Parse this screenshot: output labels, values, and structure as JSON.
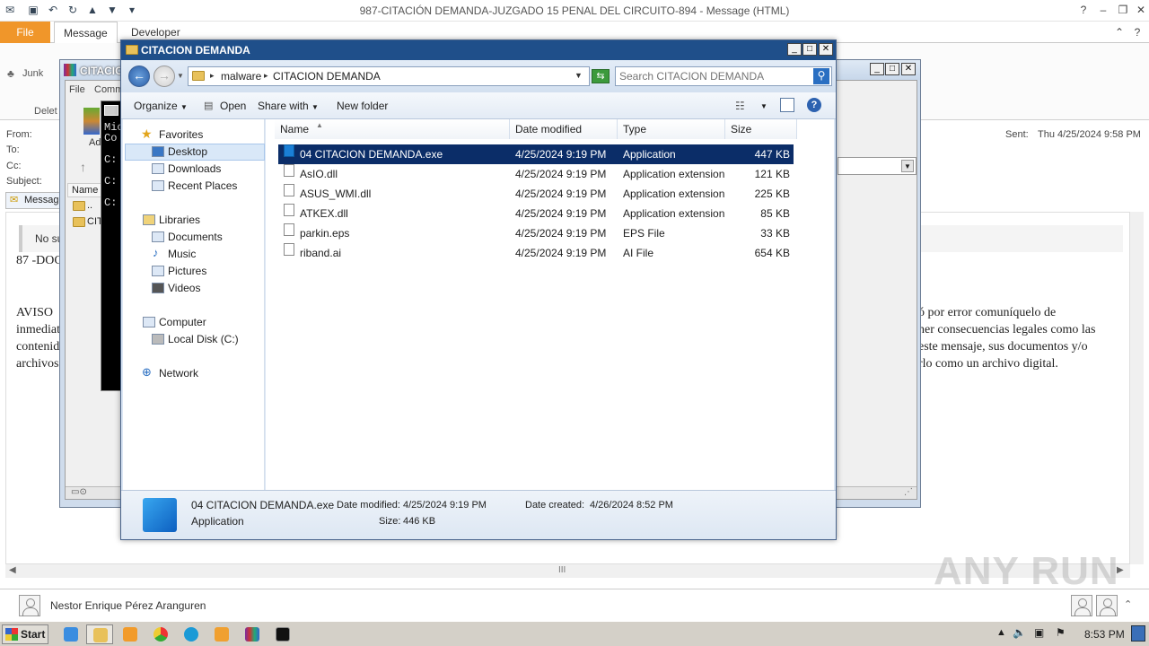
{
  "outlook": {
    "window_title": "987-CITACIÓN  DEMANDA-JUZGADO 15 PENAL DEL CIRCUITO-894  -  Message (HTML)",
    "tabs": [
      "File",
      "Message",
      "Developer"
    ],
    "ribbon": {
      "junk_label": "Junk",
      "delete_label": "Delet"
    },
    "header": {
      "from_label": "From:",
      "to_label": "To:",
      "cc_label": "Cc:",
      "subject_label": "Subject:",
      "sent_label": "Sent:",
      "sent_value": "Thu 4/25/2024 9:58 PM"
    },
    "message_tab_label": "Message",
    "body": {
      "notice_fragment": "No su",
      "line_87": "87 -DOC",
      "aviso_words": [
        "AVISO",
        "inmediat",
        "contenid",
        "archivos"
      ],
      "right_fragments": [
        "ó por error comuníquelo de",
        "ner consecuencias legales como las",
        "este mensaje, sus documentos y/o",
        "rlo como un archivo digital."
      ]
    },
    "people_name": "Nestor Enrique Pérez Aranguren",
    "hscroll_glyph": "III"
  },
  "winrar": {
    "title": "CITACIO",
    "menu": [
      "File",
      "Comm"
    ],
    "add_label": "Ad",
    "col_name": "Name",
    "rows": [
      "..",
      "CIT"
    ]
  },
  "cmd": {
    "lines": [
      "Mic",
      "Co",
      "C:",
      "C:",
      "C:"
    ]
  },
  "explorer": {
    "title": "CITACION DEMANDA",
    "breadcrumb": [
      "malware",
      "CITACION DEMANDA"
    ],
    "search_placeholder": "Search CITACION DEMANDA",
    "toolbar": {
      "organize": "Organize",
      "open": "Open",
      "share_with": "Share with",
      "new_folder": "New folder"
    },
    "nav": {
      "favorites": "Favorites",
      "favorites_items": [
        "Desktop",
        "Downloads",
        "Recent Places"
      ],
      "libraries": "Libraries",
      "libraries_items": [
        "Documents",
        "Music",
        "Pictures",
        "Videos"
      ],
      "computer": "Computer",
      "computer_items": [
        "Local Disk (C:)"
      ],
      "network": "Network",
      "selected": "Desktop"
    },
    "columns": [
      "Name",
      "Date modified",
      "Type",
      "Size"
    ],
    "files": [
      {
        "name": "04 CITACION DEMANDA.exe",
        "date": "4/25/2024 9:19 PM",
        "type": "Application",
        "size": "447 KB",
        "icon": "exe",
        "selected": true
      },
      {
        "name": "AsIO.dll",
        "date": "4/25/2024 9:19 PM",
        "type": "Application extension",
        "size": "121 KB",
        "icon": "dll"
      },
      {
        "name": "ASUS_WMI.dll",
        "date": "4/25/2024 9:19 PM",
        "type": "Application extension",
        "size": "225 KB",
        "icon": "dll"
      },
      {
        "name": "ATKEX.dll",
        "date": "4/25/2024 9:19 PM",
        "type": "Application extension",
        "size": "85 KB",
        "icon": "dll"
      },
      {
        "name": "parkin.eps",
        "date": "4/25/2024 9:19 PM",
        "type": "EPS File",
        "size": "33 KB",
        "icon": "file"
      },
      {
        "name": "riband.ai",
        "date": "4/25/2024 9:19 PM",
        "type": "AI File",
        "size": "654 KB",
        "icon": "file"
      }
    ],
    "details": {
      "name": "04 CITACION DEMANDA.exe",
      "type": "Application",
      "date_modified_label": "Date modified:",
      "date_modified": "4/25/2024 9:19 PM",
      "size_label": "Size:",
      "size": "446 KB",
      "date_created_label": "Date created:",
      "date_created": "4/26/2024 8:52 PM"
    }
  },
  "taskbar": {
    "start_label": "Start",
    "clock": "8:53 PM"
  },
  "watermark": "ANY RUN"
}
